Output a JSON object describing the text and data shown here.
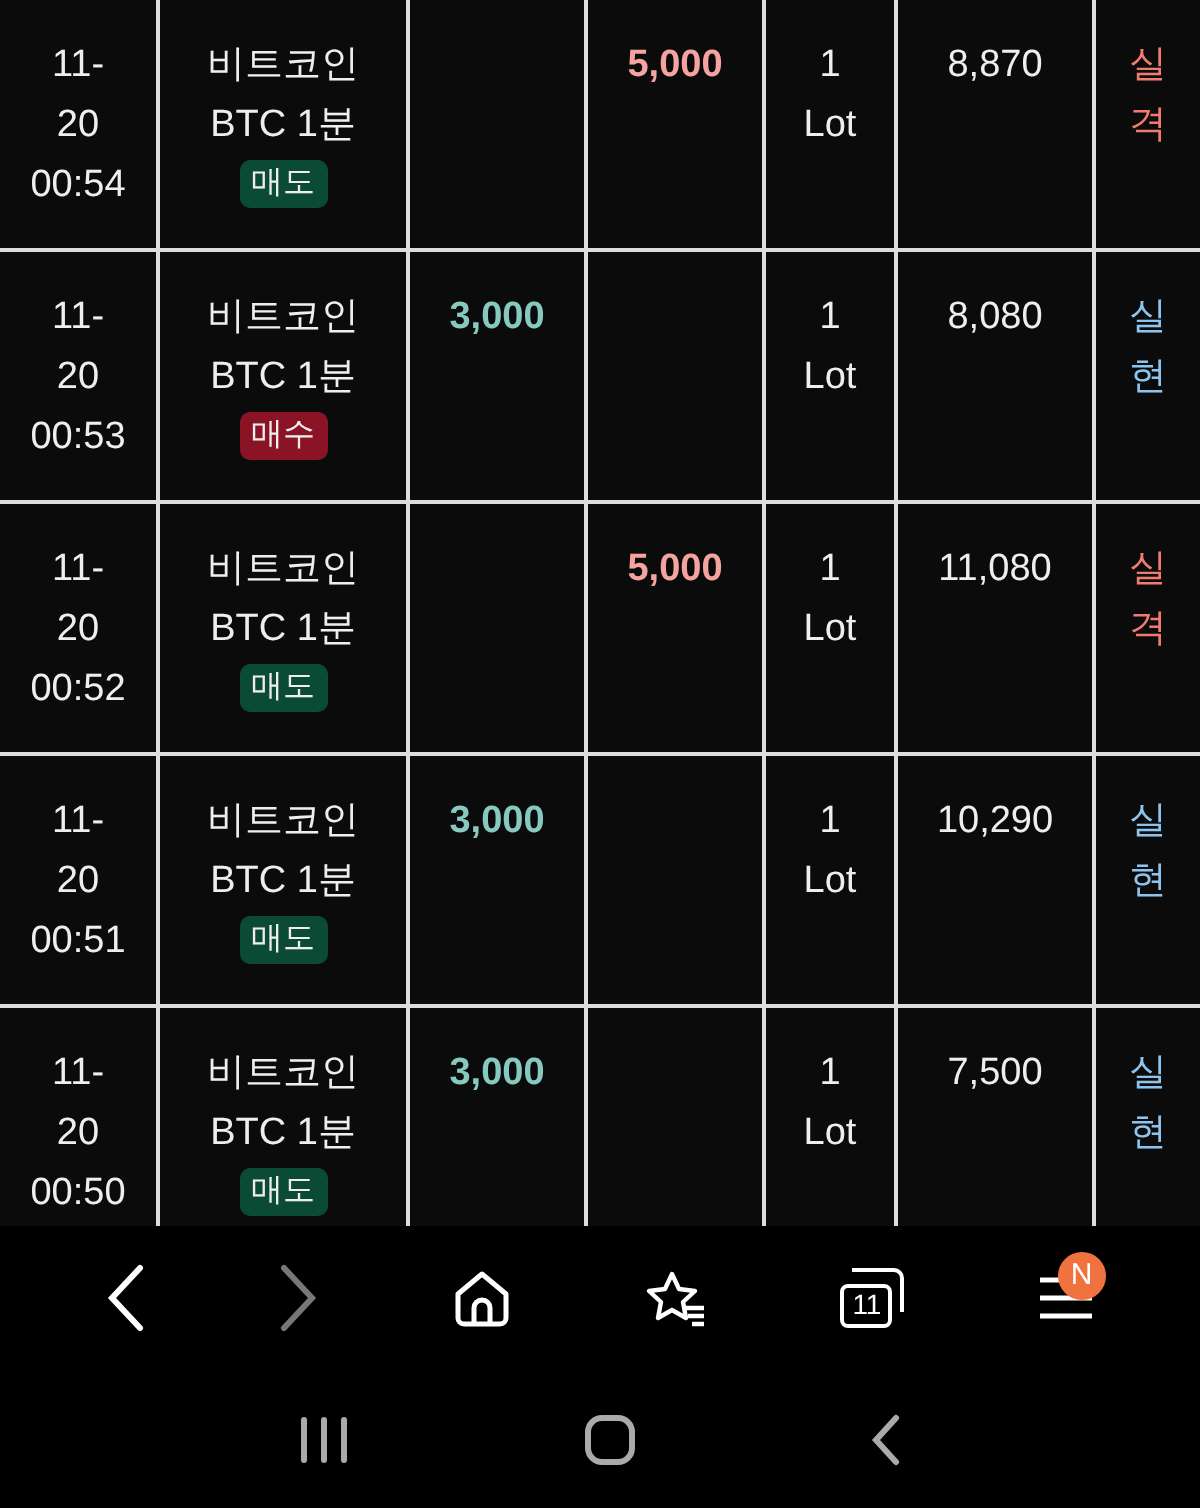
{
  "rows": [
    {
      "date": "11-",
      "day": "20",
      "time": "00:54",
      "product": "비트코인",
      "contract": "BTC 1분",
      "side": {
        "kind": "sell",
        "label": "매도"
      },
      "profit": "",
      "loss": "5,000",
      "qty": "1",
      "unit": "Lot",
      "price": "8,870",
      "result": {
        "kind": "loss",
        "label": "실격"
      }
    },
    {
      "date": "11-",
      "day": "20",
      "time": "00:53",
      "product": "비트코인",
      "contract": "BTC 1분",
      "side": {
        "kind": "buy",
        "label": "매수"
      },
      "profit": "3,000",
      "loss": "",
      "qty": "1",
      "unit": "Lot",
      "price": "8,080",
      "result": {
        "kind": "gain",
        "label": "실현"
      }
    },
    {
      "date": "11-",
      "day": "20",
      "time": "00:52",
      "product": "비트코인",
      "contract": "BTC 1분",
      "side": {
        "kind": "sell",
        "label": "매도"
      },
      "profit": "",
      "loss": "5,000",
      "qty": "1",
      "unit": "Lot",
      "price": "11,080",
      "result": {
        "kind": "loss",
        "label": "실격"
      }
    },
    {
      "date": "11-",
      "day": "20",
      "time": "00:51",
      "product": "비트코인",
      "contract": "BTC 1분",
      "side": {
        "kind": "sell",
        "label": "매도"
      },
      "profit": "3,000",
      "loss": "",
      "qty": "1",
      "unit": "Lot",
      "price": "10,290",
      "result": {
        "kind": "gain",
        "label": "실현"
      }
    },
    {
      "date": "11-",
      "day": "20",
      "time": "00:50",
      "product": "비트코인",
      "contract": "BTC 1분",
      "side": {
        "kind": "sell",
        "label": "매도"
      },
      "profit": "3,000",
      "loss": "",
      "qty": "1",
      "unit": "Lot",
      "price": "7,500",
      "result": {
        "kind": "gain",
        "label": "실현"
      }
    }
  ],
  "browser_bar": {
    "tab_count": "11",
    "menu_badge": "N"
  }
}
